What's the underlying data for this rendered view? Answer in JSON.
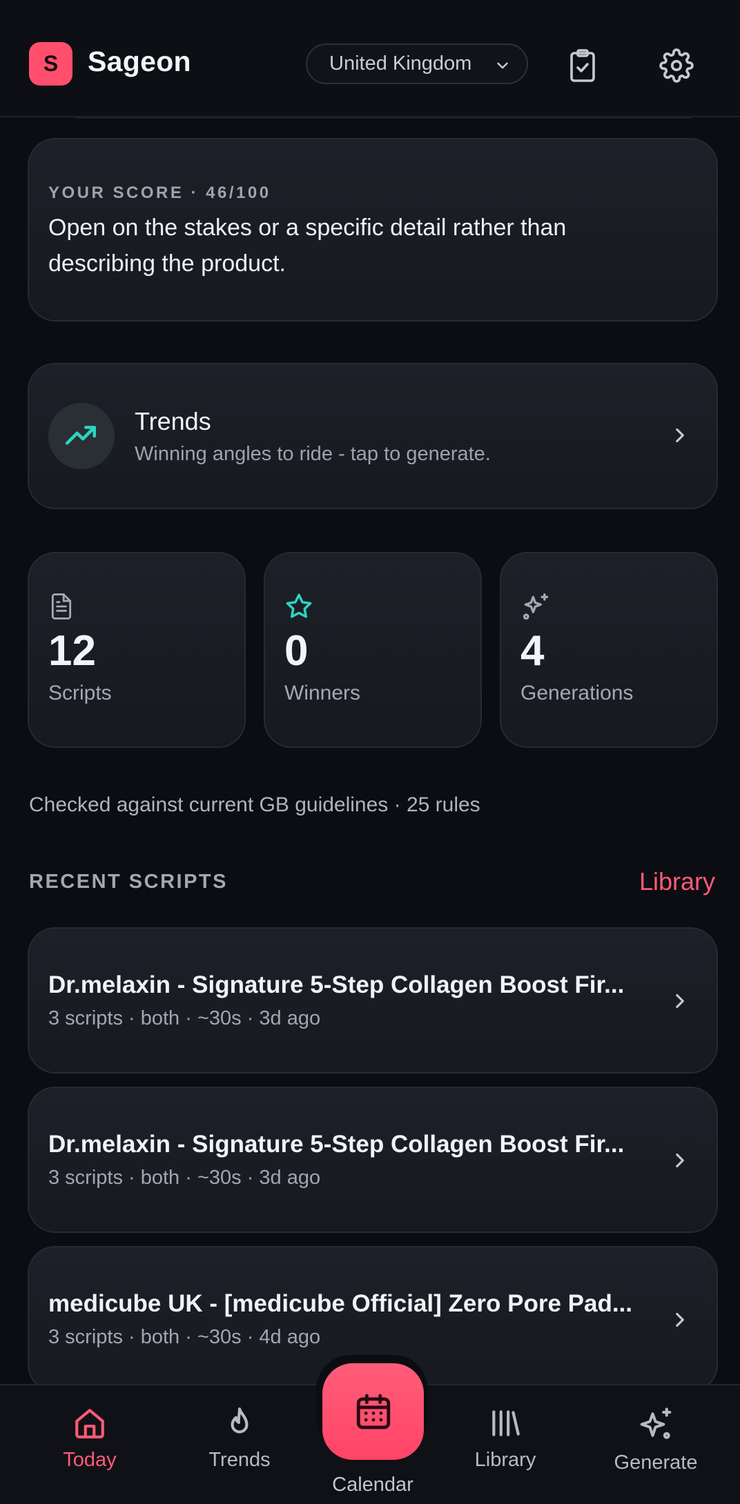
{
  "header": {
    "logo_letter": "S",
    "app_name": "Sageon",
    "region": "United Kingdom"
  },
  "score_card": {
    "label": "YOUR SCORE · 46/100",
    "text": "Open on the stakes or a specific detail rather than describing the product."
  },
  "trends_card": {
    "title": "Trends",
    "subtitle": "Winning angles to ride - tap to generate."
  },
  "stats": [
    {
      "value": "12",
      "label": "Scripts",
      "icon": "document-icon"
    },
    {
      "value": "0",
      "label": "Winners",
      "icon": "star-icon"
    },
    {
      "value": "4",
      "label": "Generations",
      "icon": "sparkles-icon"
    }
  ],
  "guidelines": "Checked against current GB guidelines · 25 rules",
  "recent": {
    "title": "RECENT SCRIPTS",
    "link": "Library",
    "items": [
      {
        "title": "Dr.melaxin - Signature 5-Step Collagen Boost Fir...",
        "meta": "3 scripts · both · ~30s · 3d ago"
      },
      {
        "title": "Dr.melaxin - Signature 5-Step Collagen Boost Fir...",
        "meta": "3 scripts · both · ~30s · 3d ago"
      },
      {
        "title": "medicube UK - [medicube Official] Zero Pore Pad...",
        "meta": "3 scripts · both · ~30s · 4d ago"
      }
    ]
  },
  "nav": {
    "today": "Today",
    "trends": "Trends",
    "calendar": "Calendar",
    "library": "Library",
    "generate": "Generate"
  },
  "colors": {
    "accent": "#ff5a76",
    "teal": "#2dd4bf",
    "background": "#0c0d12"
  }
}
